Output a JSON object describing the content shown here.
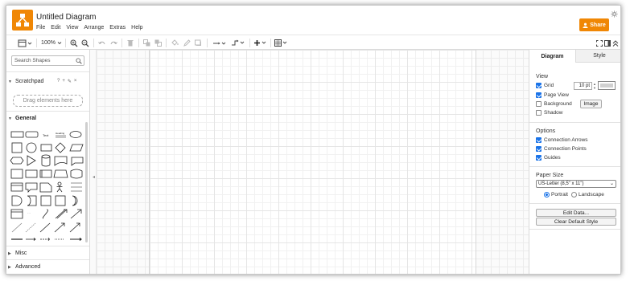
{
  "app": {
    "title": "Untitled Diagram",
    "menu": [
      "File",
      "Edit",
      "View",
      "Arrange",
      "Extras",
      "Help"
    ],
    "share_label": "Share"
  },
  "colors": {
    "accent": "#f08705",
    "checkbox": "#1a73e8"
  },
  "toolbar": {
    "zoom_label": "100%"
  },
  "sidebar": {
    "search_placeholder": "Search Shapes",
    "scratchpad_label": "Scratchpad",
    "scratchpad_icons": [
      "?",
      "+",
      "✎",
      "×"
    ],
    "drop_hint": "Drag elements here",
    "general_label": "General",
    "misc_label": "Misc",
    "advanced_label": "Advanced"
  },
  "panel": {
    "tab_diagram": "Diagram",
    "tab_style": "Style",
    "view_heading": "View",
    "grid_label": "Grid",
    "grid_checked": true,
    "grid_size": "10 pt",
    "page_view_label": "Page View",
    "page_view_checked": true,
    "background_label": "Background",
    "background_checked": false,
    "image_button": "Image",
    "shadow_label": "Shadow",
    "shadow_checked": false,
    "options_heading": "Options",
    "connection_arrows_label": "Connection Arrows",
    "connection_points_label": "Connection Points",
    "guides_label": "Guides",
    "paper_size_heading": "Paper Size",
    "paper_size_value": "US-Letter (8,5\" x 11\")",
    "portrait_label": "Portrait",
    "landscape_label": "Landscape",
    "orientation": "Portrait",
    "edit_data_button": "Edit Data...",
    "clear_default_style_button": "Clear Default Style"
  }
}
